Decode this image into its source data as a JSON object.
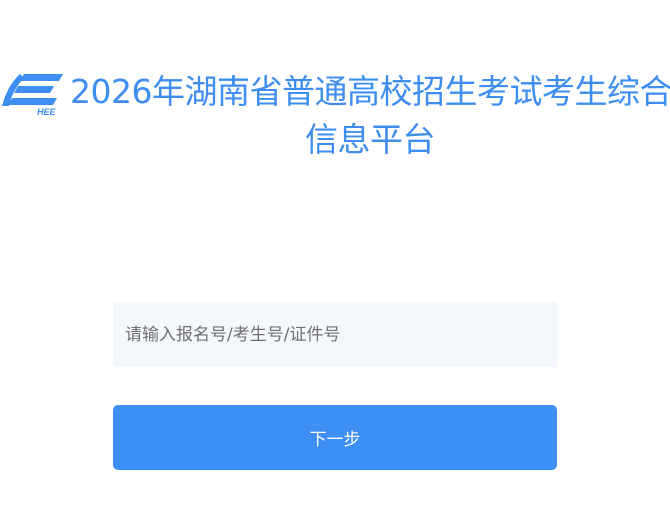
{
  "header": {
    "logo_icon": "hnee-logo-icon",
    "logo_text": "HEE",
    "title_line1": "2026年湖南省普通高校招生考试考生综合",
    "title_line2": "信息平台"
  },
  "form": {
    "id_input_value": "",
    "id_input_placeholder": "请输入报名号/考生号/证件号",
    "next_button_label": "下一步"
  },
  "colors": {
    "brand": "#3d8ef0",
    "button": "#3d8ef5",
    "input_bg": "#f4f7fb"
  }
}
